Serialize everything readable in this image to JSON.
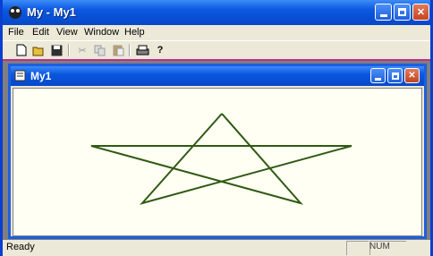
{
  "window": {
    "title": "My - My1"
  },
  "menubar": {
    "items": [
      "File",
      "Edit",
      "View",
      "Window",
      "Help"
    ]
  },
  "toolbar": {
    "buttons": [
      "new-icon",
      "open-icon",
      "save-icon",
      "cut-icon",
      "copy-icon",
      "paste-icon",
      "print-icon",
      "help-icon"
    ]
  },
  "child_window": {
    "title": "My1"
  },
  "canvas": {
    "shape": "star",
    "stroke_color": "#2f5a12",
    "background": "#fffff4"
  },
  "statusbar": {
    "text": "Ready",
    "indicator": "NUM"
  },
  "colors": {
    "titlebar": "#0a57e0",
    "accent": "#c32a8a"
  }
}
